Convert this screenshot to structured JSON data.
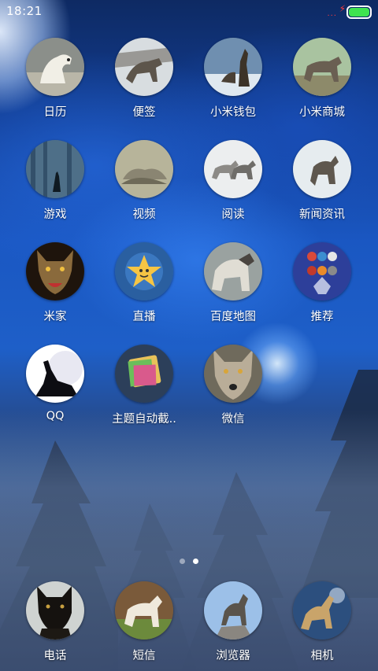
{
  "status_bar": {
    "time": "18:21",
    "signal_dots": "...",
    "charging_icon": "bolt-icon",
    "battery_level": 1.0,
    "battery_color": "#3fe34f"
  },
  "pager": {
    "page_count": 2,
    "active_page": 2
  },
  "apps": [
    {
      "label": "日历",
      "icon": "white-wolf-icon"
    },
    {
      "label": "便签",
      "icon": "wolf-in-snow-icon"
    },
    {
      "label": "小米钱包",
      "icon": "howling-wolves-icon"
    },
    {
      "label": "小米商城",
      "icon": "wolf-standing-icon"
    },
    {
      "label": "游戏",
      "icon": "wolf-silhouette-forest-icon"
    },
    {
      "label": "视频",
      "icon": "sleeping-wolves-icon"
    },
    {
      "label": "阅读",
      "icon": "two-wolves-snow-icon"
    },
    {
      "label": "新闻资讯",
      "icon": "wolf-running-snow-icon"
    },
    {
      "label": "米家",
      "icon": "snarling-wolf-icon"
    },
    {
      "label": "直播",
      "icon": "star-face-icon"
    },
    {
      "label": "百度地图",
      "icon": "grey-wolf-icon"
    },
    {
      "label": "推荐",
      "icon": "folder-apps-icon"
    },
    {
      "label": "QQ",
      "icon": "wolf-moon-howl-icon"
    },
    {
      "label": "主题自动截..",
      "icon": "screenshot-tool-icon"
    },
    {
      "label": "微信",
      "icon": "wolf-face-icon"
    }
  ],
  "dock": [
    {
      "label": "电话",
      "icon": "black-wolf-icon"
    },
    {
      "label": "短信",
      "icon": "white-wolf-grass-icon"
    },
    {
      "label": "浏览器",
      "icon": "wolf-on-rock-icon"
    },
    {
      "label": "相机",
      "icon": "howling-wolf-sky-icon"
    }
  ]
}
